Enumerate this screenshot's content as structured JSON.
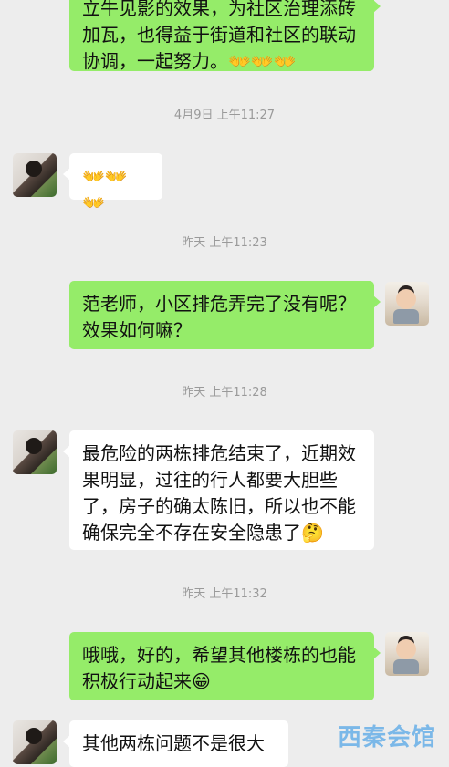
{
  "messages": {
    "m1": {
      "text": "立牛见影的效果，为社区治理添砖\n加瓦，也得益于街道和社区的联动\n协调，一起努力。👐👐👐"
    },
    "t1": "4月9日 上午11:27",
    "m2": {
      "text": "👐👐👐"
    },
    "t2": "昨天 上午11:23",
    "m3": {
      "text": "范老师，小区排危弄完了没有呢？\n效果如何嘛？"
    },
    "t3": "昨天 上午11:28",
    "m4": {
      "text": "最危险的两栋排危结束了，近期效\n果明显，过往的行人都要大胆些\n了，房子的确太陈旧，所以也不能\n确保完全不存在安全隐患了🤔"
    },
    "t4": "昨天 上午11:32",
    "m5": {
      "text": "哦哦，好的，希望其他楼栋的也能\n积极行动起来😁"
    },
    "m6": {
      "text": "其他两栋问题不是很大"
    }
  },
  "watermark": "西秦会馆"
}
